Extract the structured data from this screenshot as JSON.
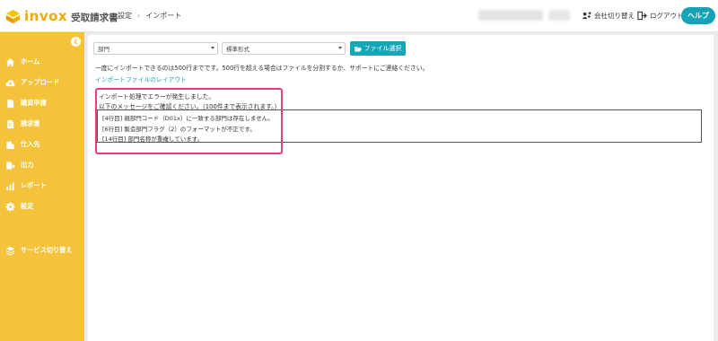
{
  "header": {
    "logo_word": "invox",
    "logo_sub": "受取請求書",
    "breadcrumb": [
      "設定",
      "インポート"
    ],
    "breadcrumb_sep": "›",
    "switch_company": "会社切り替え",
    "logout": "ログアウト",
    "help": "ヘルプ"
  },
  "sidebar": {
    "items": [
      {
        "label": "ホーム",
        "icon": "home-icon"
      },
      {
        "label": "アップロード",
        "icon": "cloud-upload-icon"
      },
      {
        "label": "購買申請",
        "icon": "document-icon"
      },
      {
        "label": "請求書",
        "icon": "invoice-icon"
      },
      {
        "label": "仕入先",
        "icon": "building-icon"
      },
      {
        "label": "出力",
        "icon": "export-icon"
      },
      {
        "label": "レポート",
        "icon": "bar-chart-icon"
      },
      {
        "label": "設定",
        "icon": "gear-icon"
      },
      {
        "label": "サービス切り替え",
        "icon": "switch-icon"
      }
    ]
  },
  "main": {
    "type_select": "部門",
    "format_select": "標準形式",
    "file_button": "ファイル選択",
    "notice": "一度にインポートできるのは500行までです。500行を超える場合はファイルを分割するか、サポートにご連絡ください。",
    "layout_link": "インポートファイルのレイアウト",
    "error_title": "インポート処理でエラーが発生しました。",
    "error_subtitle": "以下のメッセージをご確認ください。（100件まで表示されます。）",
    "errors": [
      "[4行目] 親部門コード（D01x）に一致する部門は存在しません。",
      "[6行目] 製造部門フラグ（2）のフォーマットが不正です。",
      "[14行目] 部門名称が重複しています。"
    ]
  },
  "colors": {
    "brand": "#f2a900",
    "sidebar": "#f5c33b",
    "accent": "#17a5b8",
    "highlight": "#e83e7c"
  }
}
